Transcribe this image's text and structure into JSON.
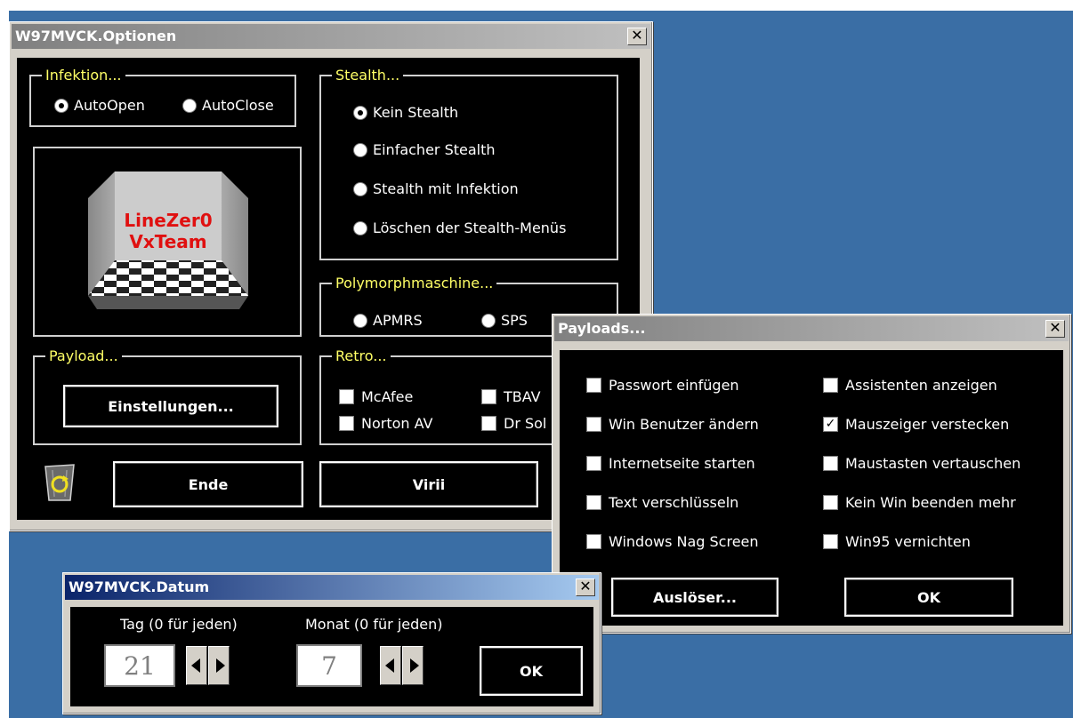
{
  "options_window": {
    "title": "W97MVCK.Optionen",
    "close": "✕",
    "infektion": {
      "legend": "Infektion...",
      "options": [
        "AutoOpen",
        "AutoClose"
      ],
      "selected": "AutoOpen"
    },
    "stealth": {
      "legend": "Stealth...",
      "options": [
        "Kein Stealth",
        "Einfacher Stealth",
        "Stealth mit Infektion",
        "Löschen der Stealth-Menüs"
      ],
      "selected": "Kein Stealth"
    },
    "poly": {
      "legend": "Polymorphmaschine...",
      "options": [
        "APMRS",
        "SPS"
      ]
    },
    "payload": {
      "legend": "Payload...",
      "button": "Einstellungen..."
    },
    "retro": {
      "legend": "Retro...",
      "items": [
        "McAfee",
        "TBAV",
        "Norton AV",
        "Dr Sol"
      ]
    },
    "logo_text": [
      "LineZer0",
      "VxTeam"
    ],
    "ende_button": "Ende",
    "virii_button": "Virii"
  },
  "payloads_window": {
    "title": "Payloads...",
    "close": "✕",
    "left": [
      "Passwort einfügen",
      "Win Benutzer ändern",
      "Internetseite starten",
      "Text verschlüsseln",
      "Windows Nag Screen"
    ],
    "right": [
      "Assistenten anzeigen",
      "Mauszeiger verstecken",
      "Maustasten vertauschen",
      "Kein Win beenden mehr",
      "Win95 vernichten"
    ],
    "checked": "Mauszeiger verstecken",
    "trigger_button": "Auslöser...",
    "ok_button": "OK"
  },
  "datum_window": {
    "title": "W97MVCK.Datum",
    "close": "✕",
    "day_label": "Tag (0 für jeden)",
    "day_value": "21",
    "month_label": "Monat (0 für jeden)",
    "month_value": "7",
    "ok_button": "OK"
  },
  "colors": {
    "desktop": "#3a6ea5",
    "legend": "#ffff66",
    "client": "#000000"
  }
}
